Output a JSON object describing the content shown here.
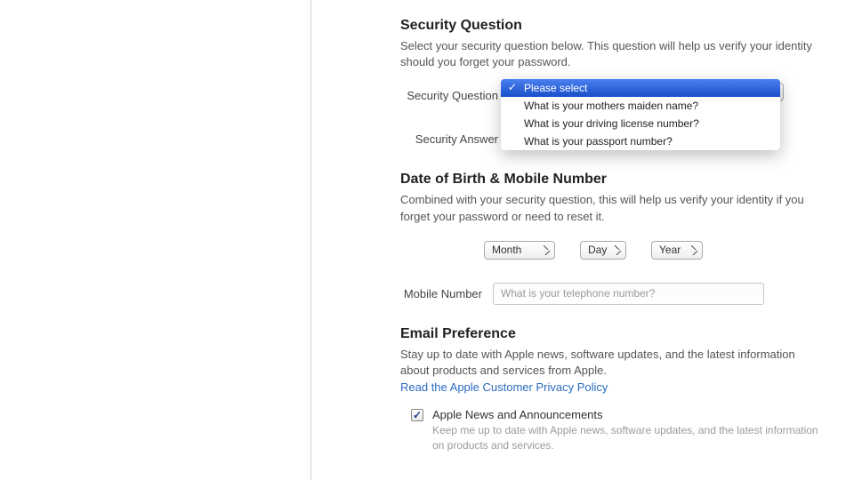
{
  "security": {
    "title": "Security Question",
    "desc": "Select your security question below. This question will help us verify your identity should you forget your password.",
    "question_label": "Security Question",
    "answer_label": "Security Answer",
    "dropdown": {
      "selected": "Please select",
      "options": [
        "Please select",
        "What is your mothers maiden name?",
        "What is your driving license number?",
        "What is your passport number?"
      ]
    }
  },
  "dob": {
    "title": "Date of Birth & Mobile Number",
    "desc": "Combined with your security question, this will help us verify your identity if you forget your password or need to reset it.",
    "month_label": "Month",
    "day_label": "Day",
    "year_label": "Year",
    "mobile_label": "Mobile Number",
    "mobile_placeholder": "What is your telephone number?"
  },
  "email_pref": {
    "title": "Email Preference",
    "desc": "Stay up to date with Apple news, software updates, and the latest information about products and services from Apple.",
    "policy_link": "Read the Apple Customer Privacy Policy",
    "checkbox_title": "Apple News and Announcements",
    "checkbox_sub": "Keep me up to date with Apple news, software updates, and the latest information on products and services."
  }
}
